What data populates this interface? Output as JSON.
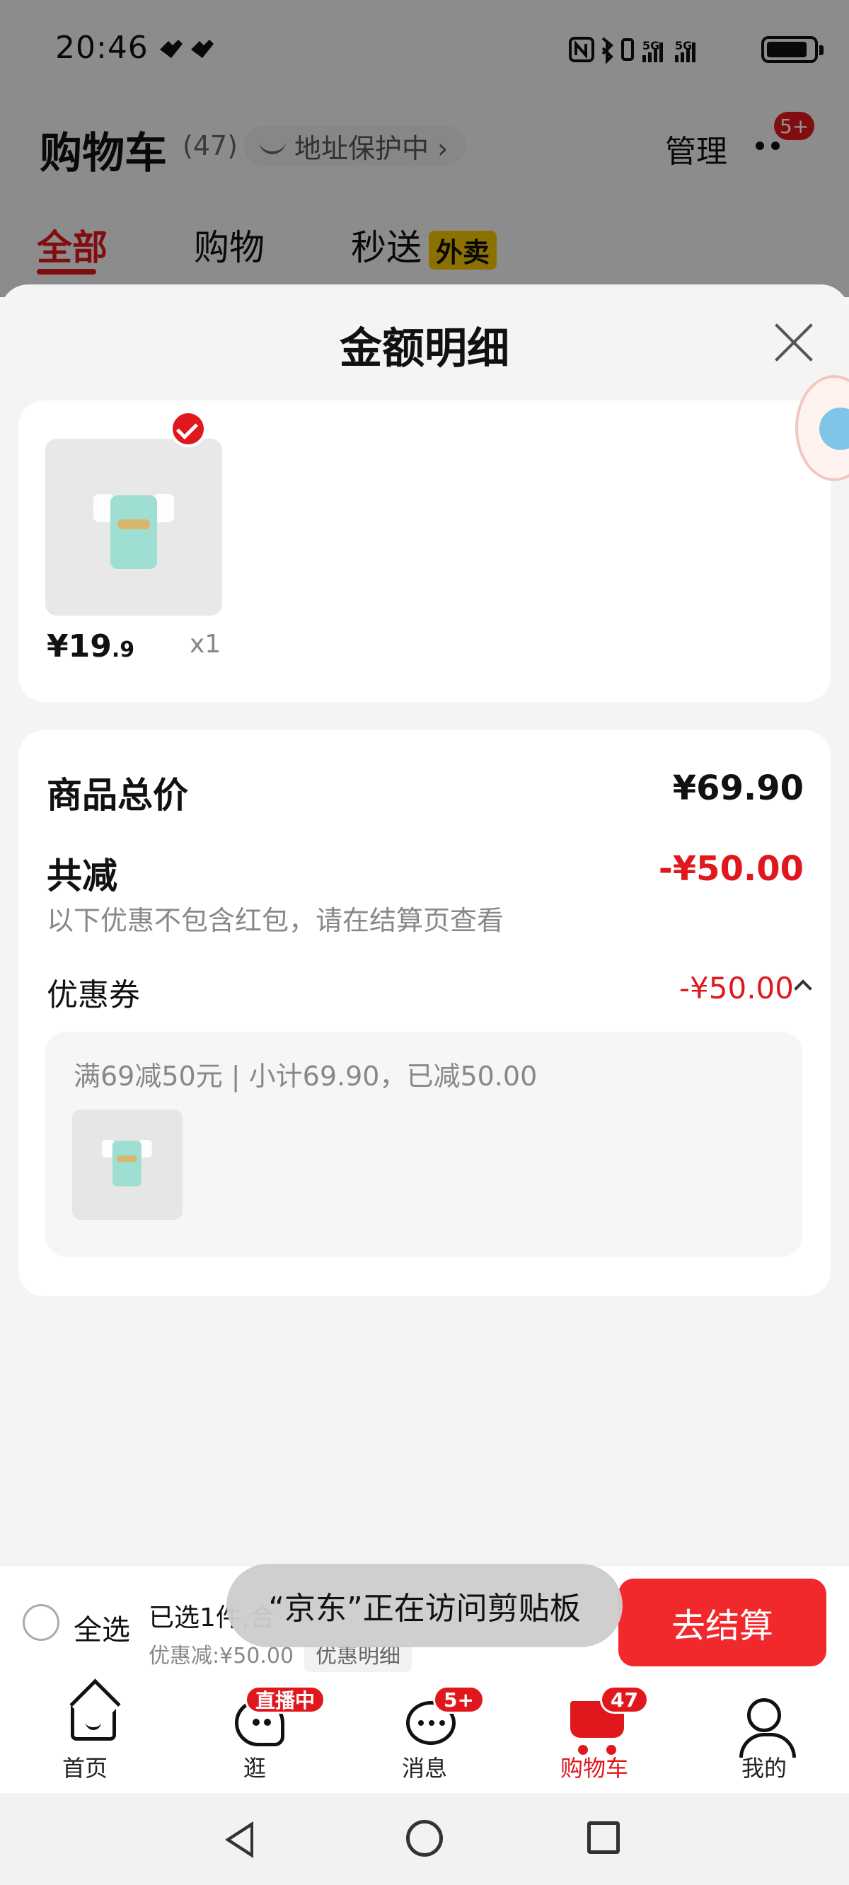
{
  "status_bar": {
    "time": "20:46",
    "network": "5G",
    "network2": "5G"
  },
  "header": {
    "title": "购物车",
    "count": "(47)",
    "address_chip": "地址保护中 ›",
    "manage": "管理",
    "more_badge": "5+"
  },
  "tabs": [
    {
      "label": "全部",
      "active": true
    },
    {
      "label": "购物",
      "active": false
    },
    {
      "label": "秒送",
      "active": false,
      "tag": "外卖"
    }
  ],
  "sheet": {
    "title": "金额明细",
    "product": {
      "price_main": "¥19",
      "price_decimal": ".9",
      "qty": "x1"
    },
    "amount": {
      "total_label": "商品总价",
      "total_value": "¥69.90",
      "reduce_label": "共减",
      "reduce_value": "-¥50.00",
      "note": "以下优惠不包含红包，请在结算页查看",
      "coupon_label": "优惠券",
      "coupon_value": "-¥50.00",
      "coupon_detail": "满69减50元 | 小计69.90，已减50.00"
    }
  },
  "checkout": {
    "select_all": "全选",
    "selected": "已选1件,合",
    "discount": "优惠减:¥50.00",
    "detail_chip": "优惠明细",
    "button": "去结算",
    "toast": "“京东”正在访问剪贴板"
  },
  "tabbar": [
    {
      "label": "首页",
      "icon": "home-icon"
    },
    {
      "label": "逛",
      "icon": "explore-icon",
      "badge": "直播中"
    },
    {
      "label": "消息",
      "icon": "message-icon",
      "badge": "5+"
    },
    {
      "label": "购物车",
      "icon": "cart-icon",
      "badge": "47",
      "active": true
    },
    {
      "label": "我的",
      "icon": "user-icon"
    }
  ],
  "colors": {
    "accent": "#e0181e",
    "checkout_button": "#f2292c",
    "tag_yellow": "#f3c300"
  }
}
